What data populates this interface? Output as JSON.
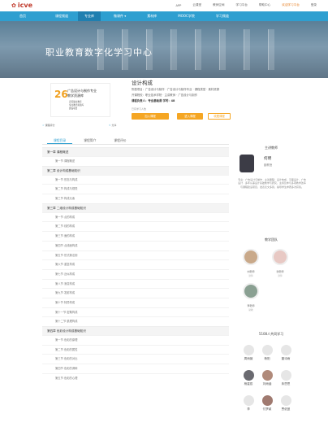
{
  "header": {
    "logo": "icve",
    "links": [
      "APP",
      "云课堂",
      "教师空间",
      "学习平台",
      "帮助中心"
    ],
    "highlight": "欢迎学习平台",
    "user": "登录"
  },
  "nav": {
    "items": [
      "首页",
      "课程频道",
      "专业库",
      "微课件",
      "素材库",
      "MOOC学院",
      "学习频道"
    ],
    "active_index": 2
  },
  "banner": {
    "title": "职业教育数字化学习中心"
  },
  "course": {
    "name": "设计构成",
    "cover": {
      "number": "26",
      "line1": "广告设计与制作专业",
      "line2": "教学资源库",
      "line3": "高等职业教育",
      "line4": "专业教学资源库",
      "line5": "建设项目"
    },
    "info_lines": [
      "所属项目：广告设计与制作 · 广告设计与制作专业  · 课程类型 · 素材资源",
      "开课院校：职业技术学院 · 主讲教师 · 广告设计与制作",
      "课程负责人：专业基础课    学时：48"
    ],
    "views": "已有学习人数",
    "buttons": {
      "join": "加入课程",
      "enter": "进入课程",
      "favorite": "收藏课程"
    },
    "rating_left": "课程评分",
    "rating_right": "分享"
  },
  "tabs": [
    "课程目录",
    "课程简介",
    "课程评价"
  ],
  "outline": [
    {
      "chapter": "第一章  课程概述",
      "sections": [
        "第一节  课程概述"
      ]
    },
    {
      "chapter": "第二章  设计构成基础知识",
      "sections": [
        "第一节  形态与构成",
        "第二节  构成与视觉",
        "第三节  构成元素"
      ]
    },
    {
      "chapter": "第三章  二维设计构成基础知识",
      "sections": [
        "第一节  点的构成",
        "第二节  线的构成",
        "第三节  面的构成",
        "第四节  点线面构成",
        "第五节  形式美法则",
        "第六节  重复构成",
        "第七节  近似构成",
        "第八节  渐变构成",
        "第九节  发射构成",
        "第十节  特异构成",
        "第十一节  密集构成",
        "第十二节  肌理构成"
      ]
    },
    {
      "chapter": "第四章  色彩设计构成基础知识",
      "sections": [
        "第一节  色彩的原理",
        "第二节  色彩的属性",
        "第三节  色彩的对比",
        "第四节  色彩的调和",
        "第五节  色彩的心理"
      ]
    }
  ],
  "sidebar": {
    "teacher_header": "主讲教师",
    "teacher_name": "何明",
    "teacher_title": "副教授",
    "teacher_bio": "专业：广告设计与制作  ·  主讲课程：设计构成、平面设计、广告设计  ·  多年从事设计基础教学与研究，主持及参与多项教学改革与课程建设项目，发表论文多篇，指导学生参赛多次获奖。",
    "team_header": "教学团队",
    "team": [
      {
        "name": "刘老师",
        "role": "讲师"
      },
      {
        "name": "张老师",
        "role": "讲师"
      },
      {
        "name": "李老师",
        "role": "助教"
      }
    ],
    "learners_header": "5108人共同学习",
    "learners": [
      "周雨薇",
      "杨阳",
      "董诗雨",
      "杨星辰",
      "刘雨涵",
      "朱思思",
      "李",
      "付梦颖",
      "贾依曼"
    ]
  },
  "colors": {
    "nav": "#2e9fd0",
    "accent": "#f5a623"
  }
}
